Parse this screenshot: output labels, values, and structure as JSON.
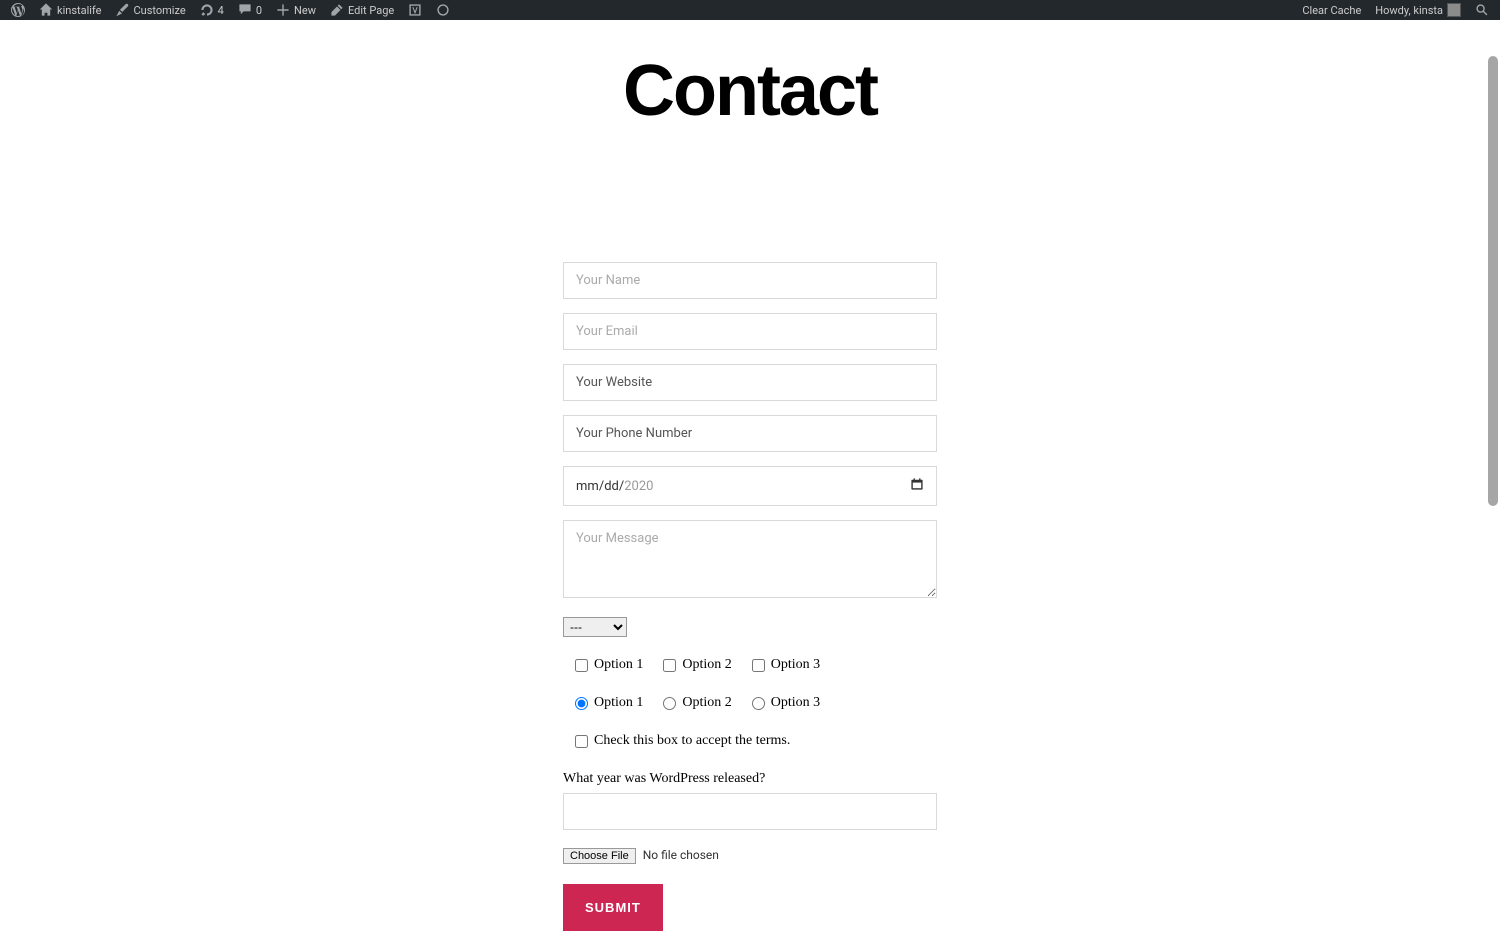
{
  "admin": {
    "site_name": "kinstalife",
    "customize": "Customize",
    "updates_count": "4",
    "comments_count": "0",
    "new_label": "New",
    "edit_page": "Edit Page",
    "clear_cache": "Clear Cache",
    "greeting": "Howdy, kinsta"
  },
  "page": {
    "title": "Contact"
  },
  "form": {
    "name_placeholder": "Your Name",
    "email_placeholder": "Your Email",
    "website_placeholder": "Your Website",
    "phone_placeholder": "Your Phone Number",
    "date_mm": "mm",
    "date_dd": "dd",
    "date_yy": "2020",
    "message_placeholder": "Your Message",
    "dropdown_selected": "---",
    "checkboxes": [
      "Option 1",
      "Option 2",
      "Option 3"
    ],
    "radios": [
      "Option 1",
      "Option 2",
      "Option 3"
    ],
    "radio_selected": 0,
    "accept_label": "Check this box to accept the terms.",
    "quiz_question": "What year was WordPress released?",
    "file_button": "Choose File",
    "file_status": "No file chosen",
    "submit_label": "SUBMIT"
  }
}
